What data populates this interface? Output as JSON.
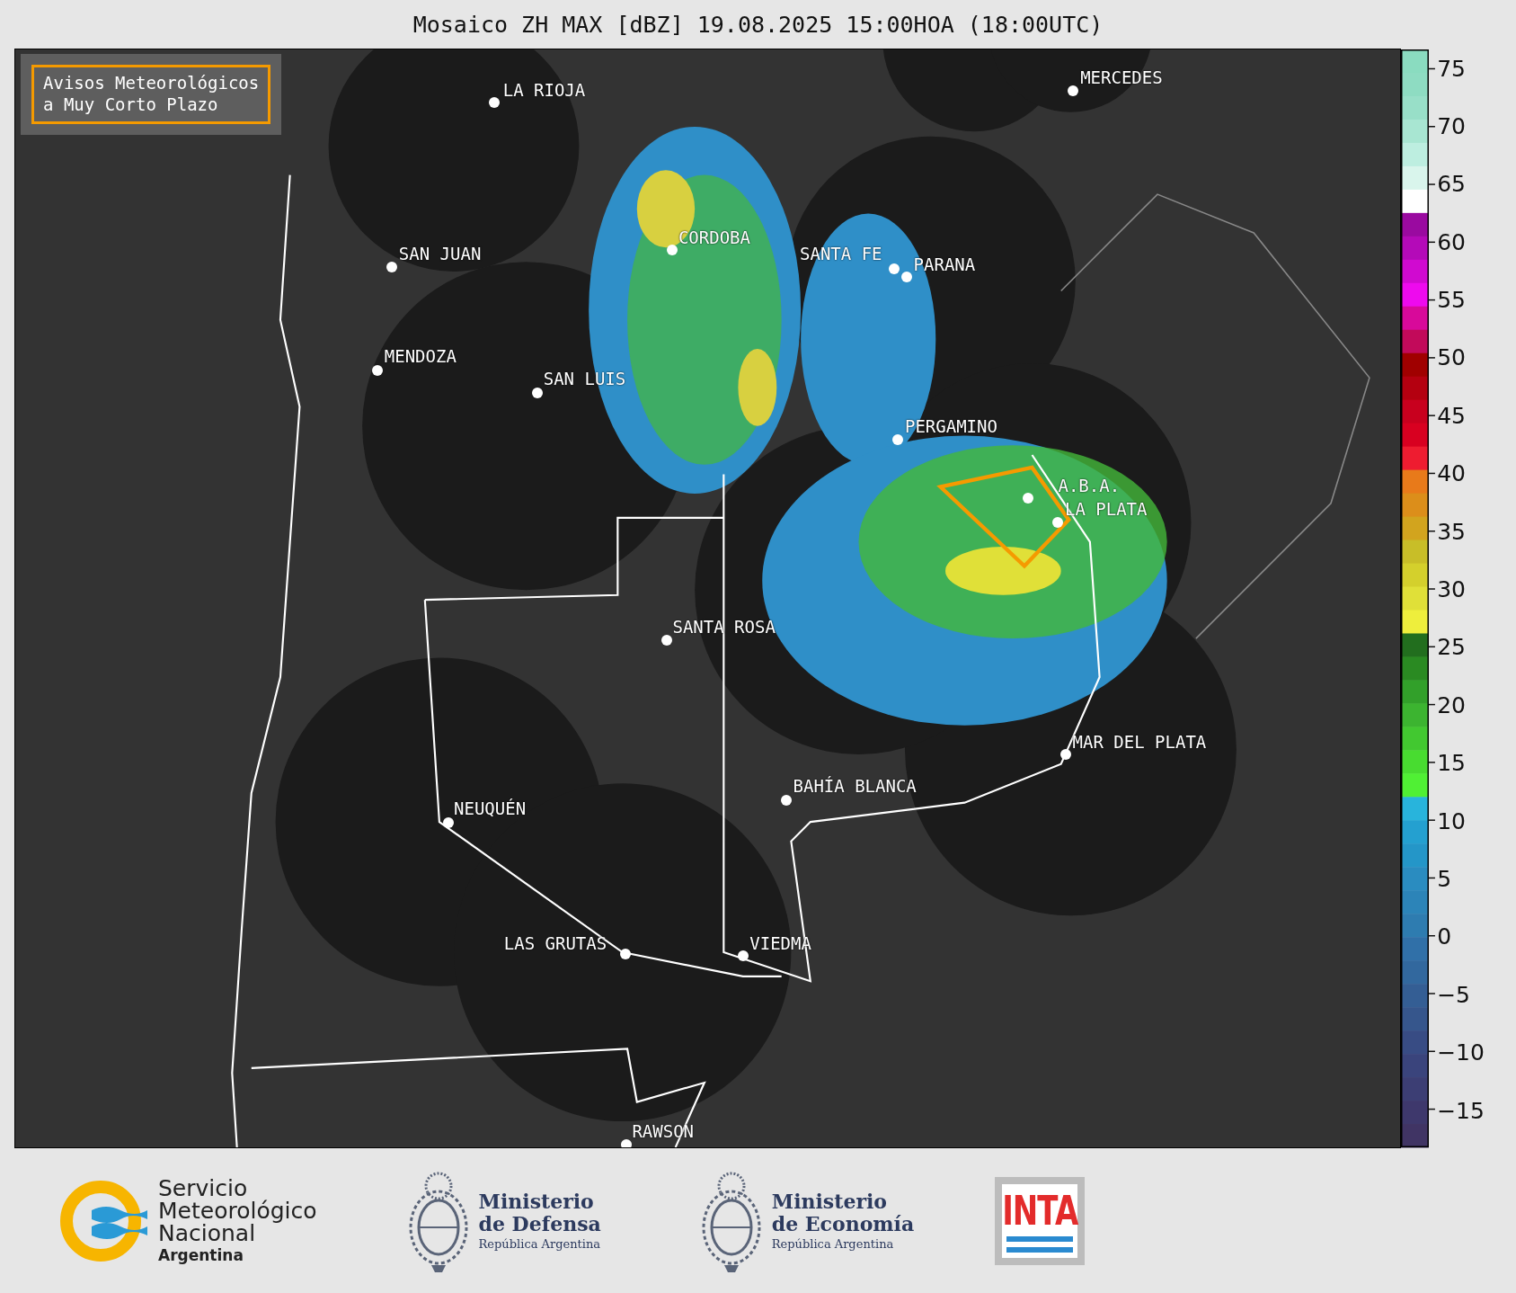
{
  "title": "Mosaico ZH MAX [dBZ] 19.08.2025 15:00HOA (18:00UTC)",
  "notice_box": {
    "lines": [
      "Avisos Meteorológicos",
      "a Muy Corto Plazo"
    ]
  },
  "cities": [
    {
      "name": "LA RIOJA"
    },
    {
      "name": "SAN JUAN"
    },
    {
      "name": "CORDOBA"
    },
    {
      "name": "SANTA FE"
    },
    {
      "name": "PARANA"
    },
    {
      "name": "MENDOZA"
    },
    {
      "name": "SAN LUIS"
    },
    {
      "name": "MERCEDES"
    },
    {
      "name": "PERGAMINO"
    },
    {
      "name": "A.B.A."
    },
    {
      "name": "LA PLATA"
    },
    {
      "name": "SANTA ROSA"
    },
    {
      "name": "MAR DEL PLATA"
    },
    {
      "name": "BAHÍA BLANCA"
    },
    {
      "name": "NEUQUÉN"
    },
    {
      "name": "LAS GRUTAS"
    },
    {
      "name": "VIEDMA"
    },
    {
      "name": "RAWSON"
    }
  ],
  "colorbar": {
    "ticks": [
      "75",
      "70",
      "65",
      "60",
      "55",
      "50",
      "45",
      "40",
      "35",
      "30",
      "25",
      "20",
      "15",
      "10",
      "5",
      "0",
      "−5",
      "−10",
      "−15"
    ]
  },
  "footer": {
    "logos": [
      {
        "kind": "smn",
        "lines": [
          "Servicio",
          "Meteorológico",
          "Nacional"
        ],
        "subtitle": "Argentina"
      },
      {
        "kind": "ministry",
        "lines": [
          "Ministerio",
          "de Defensa"
        ],
        "subtitle": "República Argentina"
      },
      {
        "kind": "ministry",
        "lines": [
          "Ministerio",
          "de Economía"
        ],
        "subtitle": "República Argentina"
      },
      {
        "kind": "inta",
        "lines": [
          "INTA"
        ]
      }
    ]
  }
}
